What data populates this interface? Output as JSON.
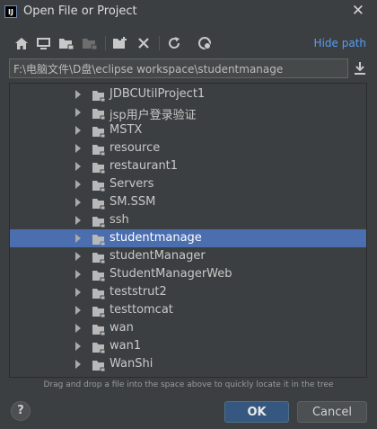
{
  "window": {
    "app_icon_text": "IJ",
    "title": "Open File or Project",
    "close_glyph": "✕"
  },
  "toolbar": {
    "icons": [
      "home-icon",
      "desktop-icon",
      "project-folder-icon",
      "module-folder-icon",
      "new-folder-icon",
      "delete-icon",
      "refresh-icon",
      "show-hidden-icon"
    ],
    "hide_path_label": "Hide path"
  },
  "path": {
    "value": "F:\\电脑文件\\D盘\\eclipse workspace\\studentmanage"
  },
  "tree": {
    "items": [
      {
        "label": "JDBCUtilProject1",
        "selected": false
      },
      {
        "label": "jsp用户登录验证",
        "selected": false
      },
      {
        "label": "MSTX",
        "selected": false
      },
      {
        "label": "resource",
        "selected": false
      },
      {
        "label": "restaurant1",
        "selected": false
      },
      {
        "label": "Servers",
        "selected": false
      },
      {
        "label": "SM.SSM",
        "selected": false
      },
      {
        "label": "ssh",
        "selected": false
      },
      {
        "label": "studentmanage",
        "selected": true
      },
      {
        "label": "studentManager",
        "selected": false
      },
      {
        "label": "StudentManagerWeb",
        "selected": false
      },
      {
        "label": "teststrut2",
        "selected": false
      },
      {
        "label": "testtomcat",
        "selected": false
      },
      {
        "label": "wan",
        "selected": false
      },
      {
        "label": "wan1",
        "selected": false
      },
      {
        "label": "WanShi",
        "selected": false
      }
    ]
  },
  "hint": "Drag and drop a file into the space above to quickly locate it in the tree",
  "buttons": {
    "help": "?",
    "ok": "OK",
    "cancel": "Cancel"
  },
  "colors": {
    "background": "#3c3f41",
    "selection": "#4b6eaf",
    "link": "#589df6",
    "ok_button": "#365880"
  }
}
